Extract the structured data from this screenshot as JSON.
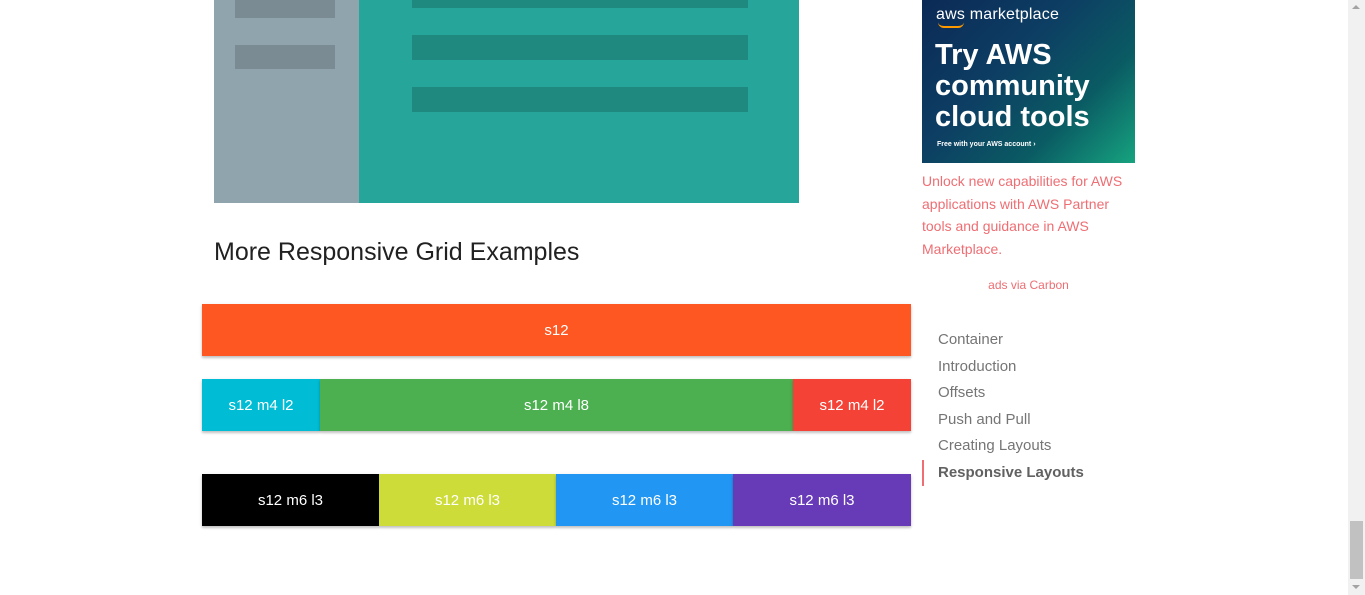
{
  "section_title": "More Responsive Grid Examples",
  "grid_rows": [
    {
      "cells": [
        {
          "label": "s12",
          "color": "#ff5722"
        }
      ]
    },
    {
      "cells": [
        {
          "label": "s12 m4 l2",
          "color": "#00bcd4"
        },
        {
          "label": "s12 m4 l8",
          "color": "#4caf50"
        },
        {
          "label": "s12 m4 l2",
          "color": "#f44336"
        }
      ]
    },
    {
      "cells": [
        {
          "label": "s12 m6 l3",
          "color": "#000000"
        },
        {
          "label": "s12 m6 l3",
          "color": "#cddc39"
        },
        {
          "label": "s12 m6 l3",
          "color": "#2196f3"
        },
        {
          "label": "s12 m6 l3",
          "color": "#673ab7"
        }
      ]
    }
  ],
  "ad": {
    "logo": "aws marketplace",
    "headline": "Try AWS community cloud tools",
    "fine_print": "Free with your AWS account ›",
    "text": "Unlock new capabilities for AWS applications with AWS Partner tools and guidance in AWS Marketplace.",
    "via": "ads via Carbon"
  },
  "toc": {
    "items": [
      {
        "label": "Container",
        "active": false
      },
      {
        "label": "Introduction",
        "active": false
      },
      {
        "label": "Offsets",
        "active": false
      },
      {
        "label": "Push and Pull",
        "active": false
      },
      {
        "label": "Creating Layouts",
        "active": false
      },
      {
        "label": "Responsive Layouts",
        "active": true
      }
    ]
  },
  "colors": {
    "accent": "#ee6e73",
    "illustration_side": "#90a4ae",
    "illustration_main": "#26a69a"
  }
}
